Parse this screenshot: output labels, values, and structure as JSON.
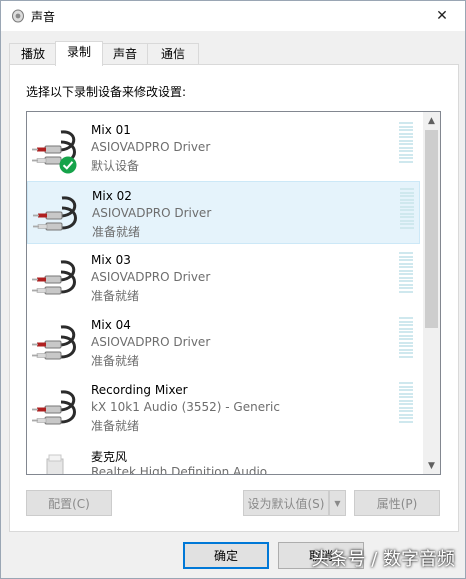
{
  "window": {
    "title": "声音",
    "close_glyph": "✕"
  },
  "tabs": [
    {
      "label": "播放",
      "active": false
    },
    {
      "label": "录制",
      "active": true
    },
    {
      "label": "声音",
      "active": false
    },
    {
      "label": "通信",
      "active": false
    }
  ],
  "instruction": "选择以下录制设备来修改设置:",
  "devices": [
    {
      "name": "Mix 01",
      "driver": "ASIOVADPRO Driver",
      "status": "默认设备",
      "icon": "rca-cable-icon",
      "default_badge": true,
      "selected": false
    },
    {
      "name": "Mix 02",
      "driver": "ASIOVADPRO Driver",
      "status": "准备就绪",
      "icon": "rca-cable-icon",
      "default_badge": false,
      "selected": true
    },
    {
      "name": "Mix 03",
      "driver": "ASIOVADPRO Driver",
      "status": "准备就绪",
      "icon": "rca-cable-icon",
      "default_badge": false,
      "selected": false
    },
    {
      "name": "Mix 04",
      "driver": "ASIOVADPRO Driver",
      "status": "准备就绪",
      "icon": "rca-cable-icon",
      "default_badge": false,
      "selected": false
    },
    {
      "name": "Recording Mixer",
      "driver": "kX 10k1 Audio (3552) - Generic",
      "status": "准备就绪",
      "icon": "rca-cable-icon",
      "default_badge": false,
      "selected": false
    },
    {
      "name": "麦克风",
      "driver": "Realtek High Definition Audio",
      "status": "",
      "icon": "microphone-icon",
      "default_badge": false,
      "selected": false
    }
  ],
  "buttons": {
    "configure": "配置(C)",
    "set_default": "设为默认值(S)",
    "properties": "属性(P)",
    "ok": "确定",
    "cancel": "取消"
  },
  "watermark": "头条号 / 数字音频",
  "colors": {
    "accent": "#0078d7",
    "selected_bg": "#e5f3fb",
    "meter": "#cfe8ee",
    "badge": "#16a34a"
  }
}
